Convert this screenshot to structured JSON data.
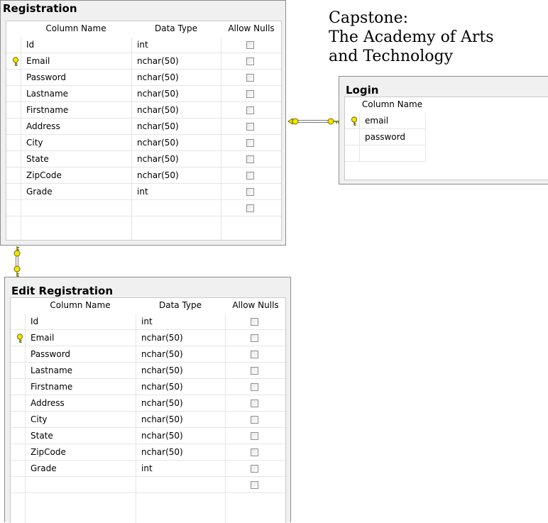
{
  "caption": {
    "line1": "Capstone:",
    "line2": "The Academy of Arts",
    "line3": "and Technology"
  },
  "tables": {
    "registration": {
      "title": "Registration",
      "headers": {
        "column_name": "Column Name",
        "data_type": "Data Type",
        "allow_nulls": "Allow Nulls"
      },
      "rows": [
        {
          "name": "Id",
          "type": "int",
          "key": false
        },
        {
          "name": "Email",
          "type": "nchar(50)",
          "key": true
        },
        {
          "name": "Password",
          "type": "nchar(50)",
          "key": false
        },
        {
          "name": "Lastname",
          "type": "nchar(50)",
          "key": false
        },
        {
          "name": "Firstname",
          "type": "nchar(50)",
          "key": false
        },
        {
          "name": "Address",
          "type": "nchar(50)",
          "key": false
        },
        {
          "name": "City",
          "type": "nchar(50)",
          "key": false
        },
        {
          "name": "State",
          "type": "nchar(50)",
          "key": false
        },
        {
          "name": "ZipCode",
          "type": "nchar(50)",
          "key": false
        },
        {
          "name": "Grade",
          "type": "int",
          "key": false
        },
        {
          "name": "",
          "type": "",
          "key": false
        }
      ]
    },
    "login": {
      "title": "Login",
      "headers": {
        "column_name": "Column Name"
      },
      "rows": [
        {
          "name": "email",
          "key": true
        },
        {
          "name": "password",
          "key": false
        },
        {
          "name": "",
          "key": false
        }
      ]
    },
    "edit_registration": {
      "title": "Edit Registration",
      "headers": {
        "column_name": "Column Name",
        "data_type": "Data Type",
        "allow_nulls": "Allow Nulls"
      },
      "rows": [
        {
          "name": "Id",
          "type": "int",
          "key": false
        },
        {
          "name": "Email",
          "type": "nchar(50)",
          "key": true
        },
        {
          "name": "Password",
          "type": "nchar(50)",
          "key": false
        },
        {
          "name": "Lastname",
          "type": "nchar(50)",
          "key": false
        },
        {
          "name": "Firstname",
          "type": "nchar(50)",
          "key": false
        },
        {
          "name": "Address",
          "type": "nchar(50)",
          "key": false
        },
        {
          "name": "City",
          "type": "nchar(50)",
          "key": false
        },
        {
          "name": "State",
          "type": "nchar(50)",
          "key": false
        },
        {
          "name": "ZipCode",
          "type": "nchar(50)",
          "key": false
        },
        {
          "name": "Grade",
          "type": "int",
          "key": false
        },
        {
          "name": "",
          "type": "",
          "key": false
        }
      ]
    }
  },
  "icons": {
    "primary_key": "key-icon",
    "relationship_end": "key-connector-icon"
  },
  "colors": {
    "key_yellow": "#f5e400",
    "key_outline": "#6b6b00",
    "table_bg": "#f0f0f0",
    "border": "#8c8c8c"
  }
}
